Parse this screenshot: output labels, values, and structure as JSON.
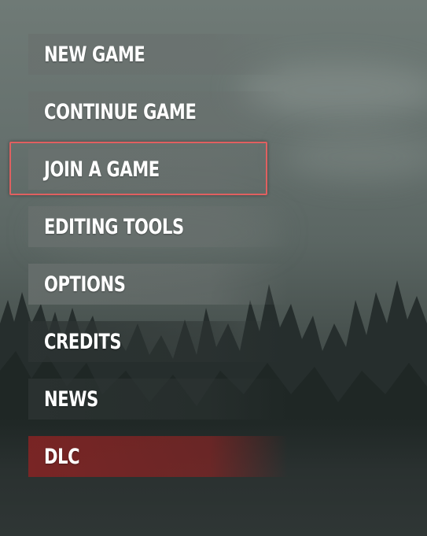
{
  "menu": {
    "items": [
      {
        "label": "NEW GAME"
      },
      {
        "label": "CONTINUE GAME"
      },
      {
        "label": "JOIN A GAME"
      },
      {
        "label": "EDITING TOOLS"
      },
      {
        "label": "OPTIONS"
      },
      {
        "label": "CREDITS"
      },
      {
        "label": "NEWS"
      },
      {
        "label": "DLC"
      }
    ],
    "highlighted_item": "JOIN A GAME"
  },
  "colors": {
    "menu_text": "#ffffff",
    "dlc_accent": "#802424",
    "highlight_border": "#e06060"
  }
}
